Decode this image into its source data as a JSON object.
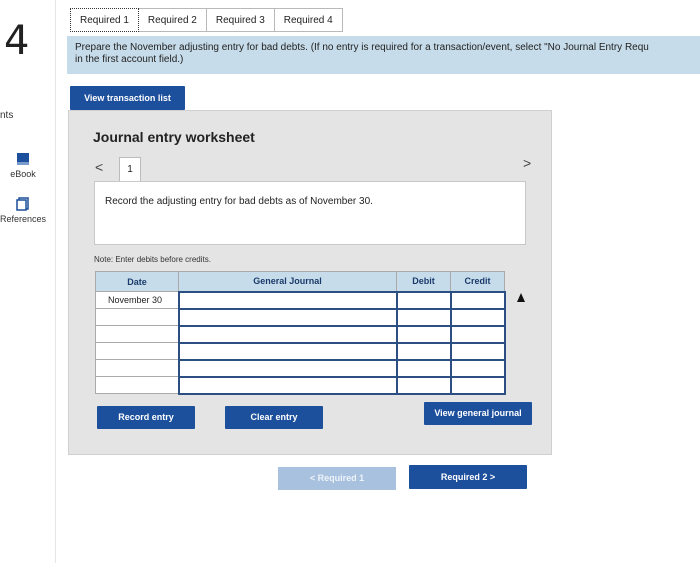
{
  "question_number": "4",
  "rail": {
    "points_label": "nts",
    "ebook_label": "eBook",
    "references_label": "References"
  },
  "tabs": [
    "Required 1",
    "Required 2",
    "Required 3",
    "Required 4"
  ],
  "instructions": {
    "line1": "Prepare the November adjusting entry for bad debts. (If no entry is required for a transaction/event, select \"No Journal Entry Requ",
    "line2": "in the first account field.)"
  },
  "view_transaction_list": "View transaction list",
  "worksheet": {
    "title": "Journal entry worksheet",
    "prev_arrow": "<",
    "next_arrow": ">",
    "page_number": "1",
    "description": "Record the adjusting entry for bad debts as of November 30.",
    "note": "Note: Enter debits before credits."
  },
  "table": {
    "headers": {
      "date": "Date",
      "journal": "General Journal",
      "debit": "Debit",
      "credit": "Credit"
    },
    "rows": [
      {
        "date": "November 30",
        "account": "",
        "debit": "",
        "credit": ""
      },
      {
        "date": "",
        "account": "",
        "debit": "",
        "credit": ""
      },
      {
        "date": "",
        "account": "",
        "debit": "",
        "credit": ""
      },
      {
        "date": "",
        "account": "",
        "debit": "",
        "credit": ""
      },
      {
        "date": "",
        "account": "",
        "debit": "",
        "credit": ""
      },
      {
        "date": "",
        "account": "",
        "debit": "",
        "credit": ""
      }
    ]
  },
  "buttons": {
    "record_entry": "Record entry",
    "clear_entry": "Clear entry",
    "view_general_journal": "View general journal"
  },
  "nav": {
    "prev_label": "< Required 1",
    "next_label": "Required 2 >"
  },
  "colors": {
    "primary_button": "#1c4f9c",
    "banner": "#c7dcea",
    "panel": "#e4e4e4"
  }
}
